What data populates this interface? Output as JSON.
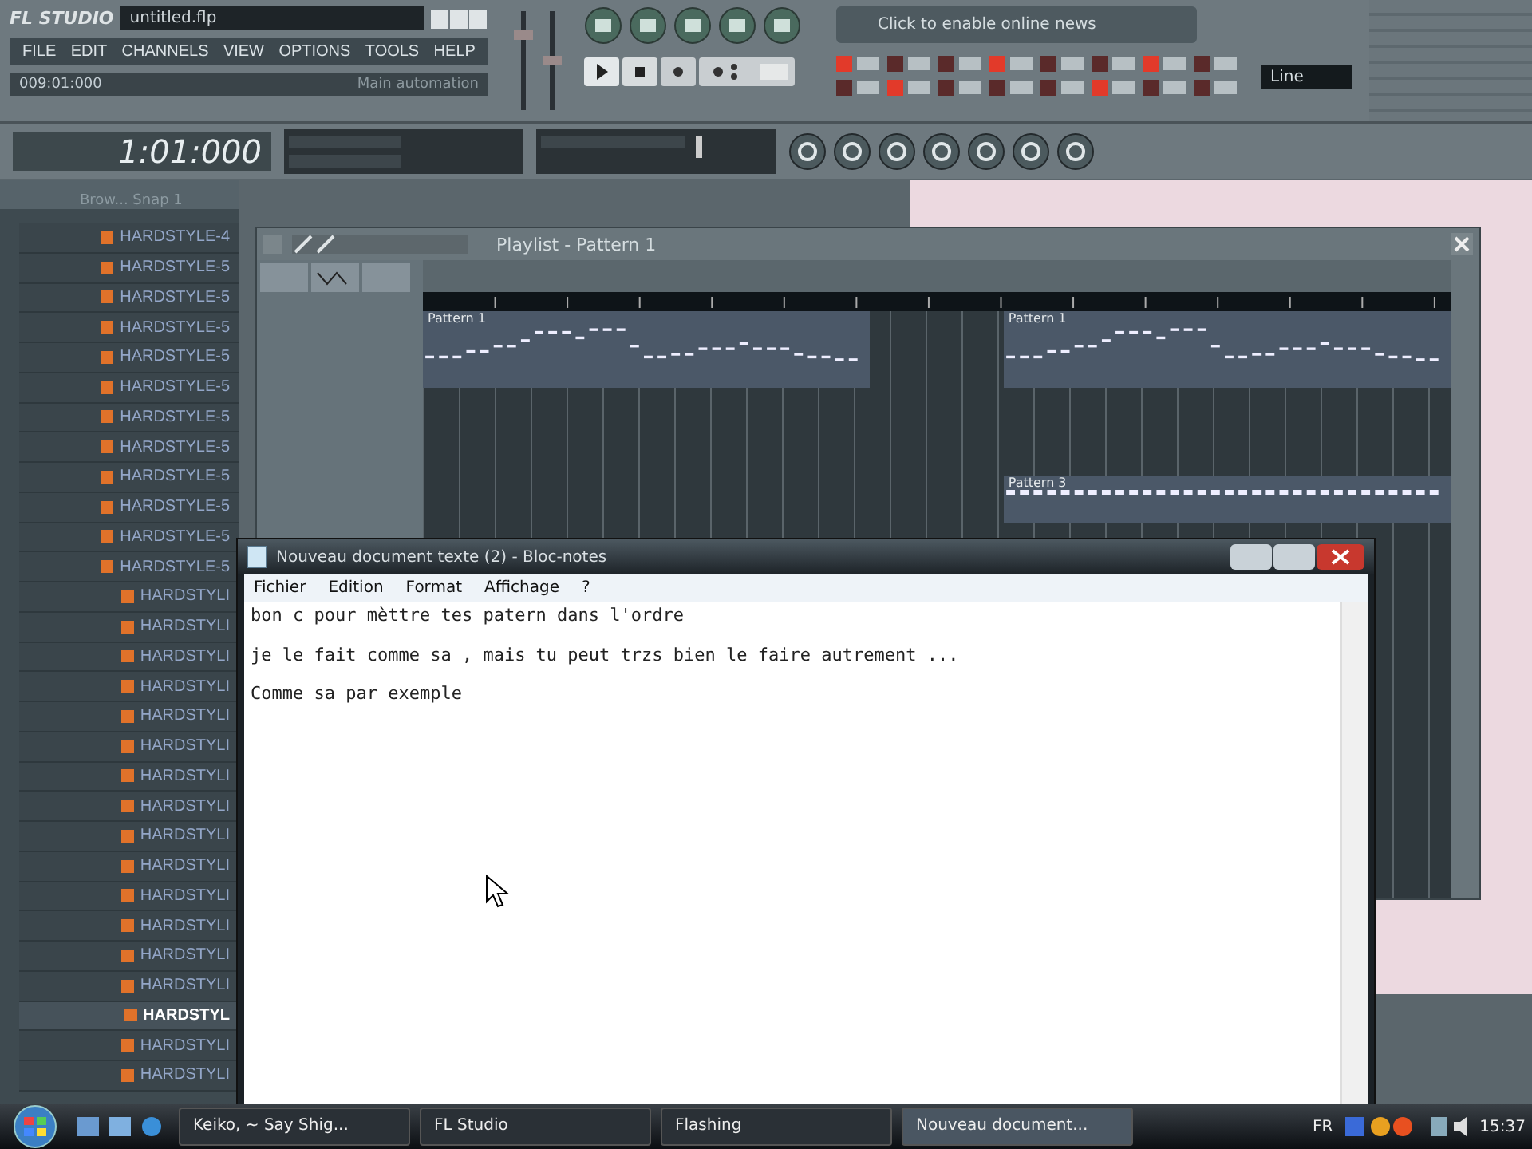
{
  "fl": {
    "logo": "FL STUDIO",
    "filename": "untitled.flp",
    "menu": [
      "FILE",
      "EDIT",
      "CHANNELS",
      "VIEW",
      "OPTIONS",
      "TOOLS",
      "HELP"
    ],
    "position": "009:01:000",
    "hint": "Main automation",
    "time": "1:01:000",
    "news": "Click to enable online news",
    "input": "Line"
  },
  "browser": {
    "title": "Brow... Snap 1",
    "items": [
      {
        "label": "HARDSTYLE-4",
        "selected": false
      },
      {
        "label": "HARDSTYLE-5",
        "selected": false
      },
      {
        "label": "HARDSTYLE-5",
        "selected": false
      },
      {
        "label": "HARDSTYLE-5",
        "selected": false
      },
      {
        "label": "HARDSTYLE-5",
        "selected": false
      },
      {
        "label": "HARDSTYLE-5",
        "selected": false
      },
      {
        "label": "HARDSTYLE-5",
        "selected": false
      },
      {
        "label": "HARDSTYLE-5",
        "selected": false
      },
      {
        "label": "HARDSTYLE-5",
        "selected": false
      },
      {
        "label": "HARDSTYLE-5",
        "selected": false
      },
      {
        "label": "HARDSTYLE-5",
        "selected": false
      },
      {
        "label": "HARDSTYLE-5",
        "selected": false
      },
      {
        "label": "HARDSTYLI",
        "selected": false
      },
      {
        "label": "HARDSTYLI",
        "selected": false
      },
      {
        "label": "HARDSTYLI",
        "selected": false
      },
      {
        "label": "HARDSTYLI",
        "selected": false
      },
      {
        "label": "HARDSTYLI",
        "selected": false
      },
      {
        "label": "HARDSTYLI",
        "selected": false
      },
      {
        "label": "HARDSTYLI",
        "selected": false
      },
      {
        "label": "HARDSTYLI",
        "selected": false
      },
      {
        "label": "HARDSTYLI",
        "selected": false
      },
      {
        "label": "HARDSTYLI",
        "selected": false
      },
      {
        "label": "HARDSTYLI",
        "selected": false
      },
      {
        "label": "HARDSTYLI",
        "selected": false
      },
      {
        "label": "HARDSTYLI",
        "selected": false
      },
      {
        "label": "HARDSTYLI",
        "selected": false
      },
      {
        "label": "HARDSTYL",
        "selected": true
      },
      {
        "label": "HARDSTYLI",
        "selected": false
      },
      {
        "label": "HARDSTYLI",
        "selected": false
      }
    ]
  },
  "playlist": {
    "title": "Playlist - Pattern 1",
    "clips": [
      {
        "label": "Pattern 1"
      },
      {
        "label": "Pattern 1"
      },
      {
        "label": "Pattern 3"
      }
    ]
  },
  "notepad": {
    "title": "Nouveau document texte (2) - Bloc-notes",
    "menu": [
      "Fichier",
      "Edition",
      "Format",
      "Affichage",
      "?"
    ],
    "lines": [
      "bon c pour mèttre tes patern dans l'ordre",
      "je le fait comme sa , mais tu peut trzs bien le faire autrement ...",
      "Comme sa par exemple"
    ]
  },
  "taskbar": {
    "tasks": [
      {
        "label": "Keiko, ~ Say Shig...",
        "selected": false
      },
      {
        "label": "FL Studio",
        "selected": false
      },
      {
        "label": "Flashing",
        "selected": false
      },
      {
        "label": "Nouveau document...",
        "selected": true
      }
    ],
    "language": "FR",
    "clock": "15:37"
  }
}
